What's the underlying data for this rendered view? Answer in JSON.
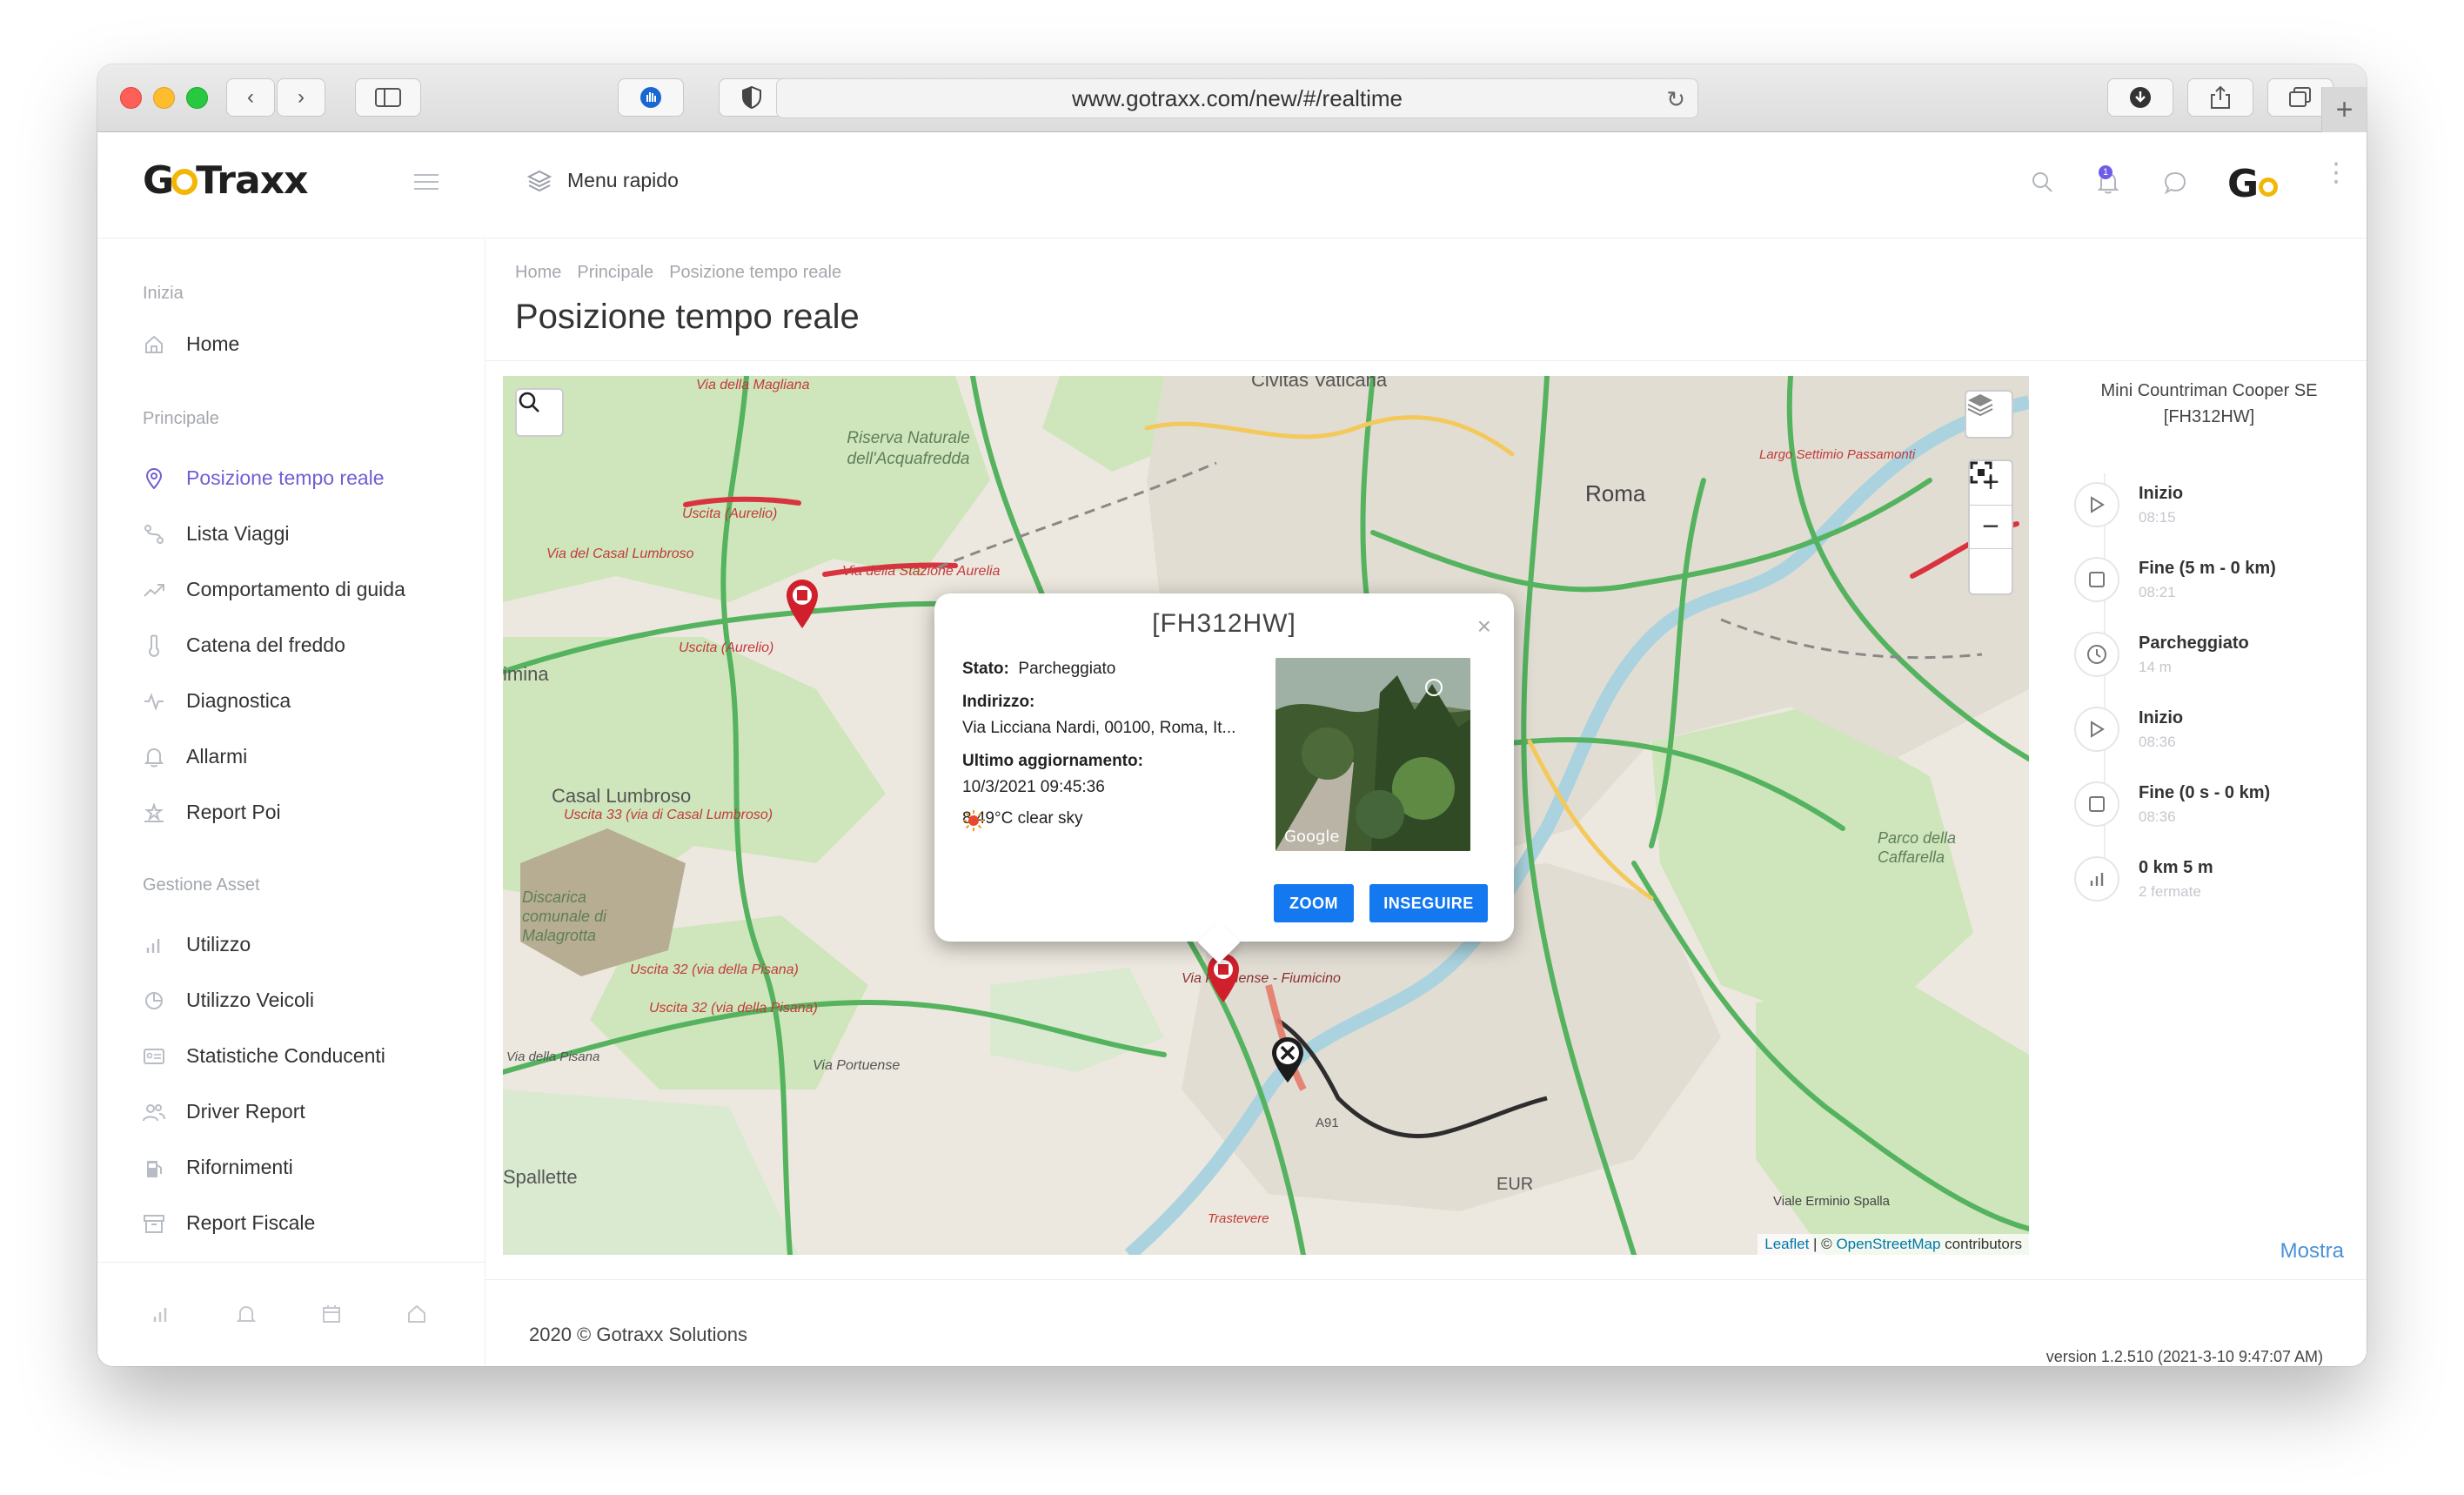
{
  "browser": {
    "url": "www.gotraxx.com/new/#/realtime"
  },
  "header": {
    "logo_text_before": "G",
    "logo_text_after": "Traxx",
    "quick_menu_label": "Menu rapido",
    "notification_count": "1",
    "avatar_text": "G"
  },
  "sidebar": {
    "sections": [
      {
        "title": "Inizia"
      },
      {
        "title": "Principale"
      },
      {
        "title": "Gestione Asset"
      }
    ],
    "items": [
      {
        "label": "Home",
        "icon": "home-icon"
      },
      {
        "label": "Posizione tempo reale",
        "icon": "location-pin-icon",
        "active": true
      },
      {
        "label": "Lista Viaggi",
        "icon": "route-icon"
      },
      {
        "label": "Comportamento di guida",
        "icon": "trend-icon"
      },
      {
        "label": "Catena del freddo",
        "icon": "thermometer-icon"
      },
      {
        "label": "Diagnostica",
        "icon": "pulse-icon"
      },
      {
        "label": "Allarmi",
        "icon": "bell-icon"
      },
      {
        "label": "Report Poi",
        "icon": "poi-icon"
      },
      {
        "label": "Utilizzo",
        "icon": "bar-chart-icon"
      },
      {
        "label": "Utilizzo Veicoli",
        "icon": "pie-chart-icon"
      },
      {
        "label": "Statistiche Conducenti",
        "icon": "id-card-icon"
      },
      {
        "label": "Driver Report",
        "icon": "users-icon"
      },
      {
        "label": "Rifornimenti",
        "icon": "fuel-icon"
      },
      {
        "label": "Report Fiscale",
        "icon": "archive-icon"
      }
    ]
  },
  "main": {
    "breadcrumb": [
      "Home",
      "Principale",
      "Posizione tempo reale"
    ],
    "title": "Posizione tempo reale"
  },
  "map": {
    "labels": {
      "roma": "Roma",
      "civitas": "Civitas Vaticana",
      "casal_lumbroso": "Casal Lumbroso",
      "uscita33": "Uscita 33 (via di Casal Lumbroso)",
      "discarica": "Discarica comunale di Malagrotta",
      "spallette": "Spallette",
      "imina": "imina",
      "riserva": "Riserva Naturale dell'Acquafredda",
      "parco": "Parco della Caffarella",
      "eur": "EUR",
      "via_magliana": "Via della Magliana",
      "via_aurelia": "Via della Stazione Aurelia",
      "via_casal": "Via del Casal Lumbroso",
      "uscita_aurelio": "Uscita (Aurelio)",
      "uscita_aurelio2": "Uscita (Aurelio)",
      "uscita32a": "Uscita 32 (via della Pisana)",
      "uscita32b": "Uscita 32 (via della Pisana)",
      "via_portuense": "Via Portuense",
      "via_pisana": "Via della Pisana",
      "fiumicino": "Via Portuense - Fiumicino",
      "largo": "Largo Settimio Passamonti",
      "erminio": "Viale Erminio Spalla",
      "trastevere": "Trastevere",
      "a91": "A91"
    },
    "attribution_leaflet": "Leaflet",
    "attribution_sep": " | © ",
    "attribution_osm": "OpenStreetMap",
    "attribution_tail": " contributors"
  },
  "popup": {
    "title": "[FH312HW]",
    "stato_label": "Stato:",
    "stato_value": "Parcheggiato",
    "indirizzo_label": "Indirizzo:",
    "indirizzo_value": "Via Licciana Nardi, 00100, Roma, It...",
    "aggiornamento_label": "Ultimo aggiornamento:",
    "aggiornamento_value": "10/3/2021 09:45:36",
    "weather": "8.49°C clear sky",
    "streetview_brand": "Google",
    "zoom_button": "ZOOM",
    "follow_button": "INSEGUIRE"
  },
  "right_panel": {
    "vehicle_line1": "Mini Countriman Cooper SE",
    "vehicle_line2": "[FH312HW]",
    "events": [
      {
        "title": "Inizio",
        "sub": "08:15",
        "icon": "play-icon"
      },
      {
        "title": "Fine (5 m - 0 km)",
        "sub": "08:21",
        "icon": "stop-icon"
      },
      {
        "title": "Parcheggiato",
        "sub": "14 m",
        "icon": "clock-icon"
      },
      {
        "title": "Inizio",
        "sub": "08:36",
        "icon": "play-icon"
      },
      {
        "title": "Fine (0 s - 0 km)",
        "sub": "08:36",
        "icon": "stop-icon"
      },
      {
        "title": "0 km 5 m",
        "sub": "2 fermate",
        "icon": "stats-icon"
      }
    ],
    "mostra_link": "Mostra"
  },
  "footer": {
    "copyright": "2020 © Gotraxx Solutions",
    "version": "version 1.2.510 (2021-3-10 9:47:07 AM)"
  },
  "colors": {
    "accent": "#6f5fd3",
    "primary_button": "#1478f0",
    "marker_red": "#d0202b",
    "route_dark": "#2d2d2d"
  }
}
